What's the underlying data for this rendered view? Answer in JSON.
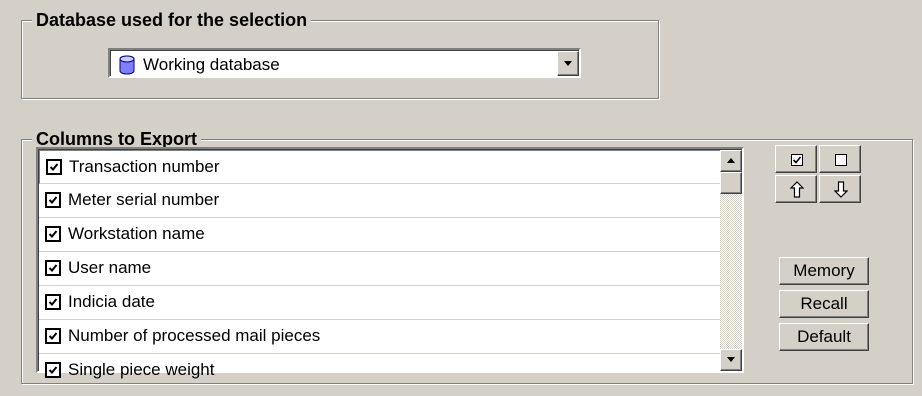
{
  "database_group": {
    "title": "Database used for the selection",
    "selected": "Working database"
  },
  "columns_group": {
    "title": "Columns to Export",
    "items": [
      {
        "label": "Transaction number",
        "checked": true
      },
      {
        "label": "Meter serial number",
        "checked": true
      },
      {
        "label": "Workstation name",
        "checked": true
      },
      {
        "label": "User name",
        "checked": true
      },
      {
        "label": "Indicia date",
        "checked": true
      },
      {
        "label": "Number of processed mail pieces",
        "checked": true
      },
      {
        "label": "Single piece weight",
        "checked": true
      }
    ]
  },
  "buttons": {
    "memory": "Memory",
    "recall": "Recall",
    "default": "Default"
  },
  "icons": {
    "check_all": "checked-box-icon",
    "uncheck_all": "empty-box-icon",
    "move_up": "arrow-up-icon",
    "move_down": "arrow-down-icon",
    "database": "database-cylinder-icon"
  }
}
